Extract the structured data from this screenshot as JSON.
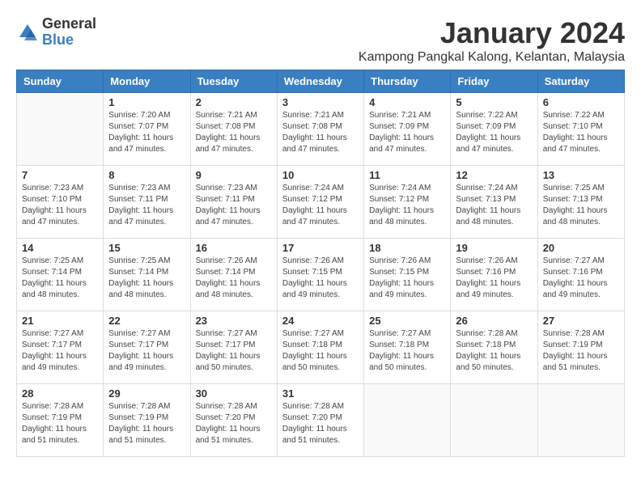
{
  "logo": {
    "general": "General",
    "blue": "Blue"
  },
  "header": {
    "month": "January 2024",
    "location": "Kampong Pangkal Kalong, Kelantan, Malaysia"
  },
  "weekdays": [
    "Sunday",
    "Monday",
    "Tuesday",
    "Wednesday",
    "Thursday",
    "Friday",
    "Saturday"
  ],
  "weeks": [
    [
      {
        "day": "",
        "sunrise": "",
        "sunset": "",
        "daylight": ""
      },
      {
        "day": "1",
        "sunrise": "Sunrise: 7:20 AM",
        "sunset": "Sunset: 7:07 PM",
        "daylight": "Daylight: 11 hours and 47 minutes."
      },
      {
        "day": "2",
        "sunrise": "Sunrise: 7:21 AM",
        "sunset": "Sunset: 7:08 PM",
        "daylight": "Daylight: 11 hours and 47 minutes."
      },
      {
        "day": "3",
        "sunrise": "Sunrise: 7:21 AM",
        "sunset": "Sunset: 7:08 PM",
        "daylight": "Daylight: 11 hours and 47 minutes."
      },
      {
        "day": "4",
        "sunrise": "Sunrise: 7:21 AM",
        "sunset": "Sunset: 7:09 PM",
        "daylight": "Daylight: 11 hours and 47 minutes."
      },
      {
        "day": "5",
        "sunrise": "Sunrise: 7:22 AM",
        "sunset": "Sunset: 7:09 PM",
        "daylight": "Daylight: 11 hours and 47 minutes."
      },
      {
        "day": "6",
        "sunrise": "Sunrise: 7:22 AM",
        "sunset": "Sunset: 7:10 PM",
        "daylight": "Daylight: 11 hours and 47 minutes."
      }
    ],
    [
      {
        "day": "7",
        "sunrise": "Sunrise: 7:23 AM",
        "sunset": "Sunset: 7:10 PM",
        "daylight": "Daylight: 11 hours and 47 minutes."
      },
      {
        "day": "8",
        "sunrise": "Sunrise: 7:23 AM",
        "sunset": "Sunset: 7:11 PM",
        "daylight": "Daylight: 11 hours and 47 minutes."
      },
      {
        "day": "9",
        "sunrise": "Sunrise: 7:23 AM",
        "sunset": "Sunset: 7:11 PM",
        "daylight": "Daylight: 11 hours and 47 minutes."
      },
      {
        "day": "10",
        "sunrise": "Sunrise: 7:24 AM",
        "sunset": "Sunset: 7:12 PM",
        "daylight": "Daylight: 11 hours and 47 minutes."
      },
      {
        "day": "11",
        "sunrise": "Sunrise: 7:24 AM",
        "sunset": "Sunset: 7:12 PM",
        "daylight": "Daylight: 11 hours and 48 minutes."
      },
      {
        "day": "12",
        "sunrise": "Sunrise: 7:24 AM",
        "sunset": "Sunset: 7:13 PM",
        "daylight": "Daylight: 11 hours and 48 minutes."
      },
      {
        "day": "13",
        "sunrise": "Sunrise: 7:25 AM",
        "sunset": "Sunset: 7:13 PM",
        "daylight": "Daylight: 11 hours and 48 minutes."
      }
    ],
    [
      {
        "day": "14",
        "sunrise": "Sunrise: 7:25 AM",
        "sunset": "Sunset: 7:14 PM",
        "daylight": "Daylight: 11 hours and 48 minutes."
      },
      {
        "day": "15",
        "sunrise": "Sunrise: 7:25 AM",
        "sunset": "Sunset: 7:14 PM",
        "daylight": "Daylight: 11 hours and 48 minutes."
      },
      {
        "day": "16",
        "sunrise": "Sunrise: 7:26 AM",
        "sunset": "Sunset: 7:14 PM",
        "daylight": "Daylight: 11 hours and 48 minutes."
      },
      {
        "day": "17",
        "sunrise": "Sunrise: 7:26 AM",
        "sunset": "Sunset: 7:15 PM",
        "daylight": "Daylight: 11 hours and 49 minutes."
      },
      {
        "day": "18",
        "sunrise": "Sunrise: 7:26 AM",
        "sunset": "Sunset: 7:15 PM",
        "daylight": "Daylight: 11 hours and 49 minutes."
      },
      {
        "day": "19",
        "sunrise": "Sunrise: 7:26 AM",
        "sunset": "Sunset: 7:16 PM",
        "daylight": "Daylight: 11 hours and 49 minutes."
      },
      {
        "day": "20",
        "sunrise": "Sunrise: 7:27 AM",
        "sunset": "Sunset: 7:16 PM",
        "daylight": "Daylight: 11 hours and 49 minutes."
      }
    ],
    [
      {
        "day": "21",
        "sunrise": "Sunrise: 7:27 AM",
        "sunset": "Sunset: 7:17 PM",
        "daylight": "Daylight: 11 hours and 49 minutes."
      },
      {
        "day": "22",
        "sunrise": "Sunrise: 7:27 AM",
        "sunset": "Sunset: 7:17 PM",
        "daylight": "Daylight: 11 hours and 49 minutes."
      },
      {
        "day": "23",
        "sunrise": "Sunrise: 7:27 AM",
        "sunset": "Sunset: 7:17 PM",
        "daylight": "Daylight: 11 hours and 50 minutes."
      },
      {
        "day": "24",
        "sunrise": "Sunrise: 7:27 AM",
        "sunset": "Sunset: 7:18 PM",
        "daylight": "Daylight: 11 hours and 50 minutes."
      },
      {
        "day": "25",
        "sunrise": "Sunrise: 7:27 AM",
        "sunset": "Sunset: 7:18 PM",
        "daylight": "Daylight: 11 hours and 50 minutes."
      },
      {
        "day": "26",
        "sunrise": "Sunrise: 7:28 AM",
        "sunset": "Sunset: 7:18 PM",
        "daylight": "Daylight: 11 hours and 50 minutes."
      },
      {
        "day": "27",
        "sunrise": "Sunrise: 7:28 AM",
        "sunset": "Sunset: 7:19 PM",
        "daylight": "Daylight: 11 hours and 51 minutes."
      }
    ],
    [
      {
        "day": "28",
        "sunrise": "Sunrise: 7:28 AM",
        "sunset": "Sunset: 7:19 PM",
        "daylight": "Daylight: 11 hours and 51 minutes."
      },
      {
        "day": "29",
        "sunrise": "Sunrise: 7:28 AM",
        "sunset": "Sunset: 7:19 PM",
        "daylight": "Daylight: 11 hours and 51 minutes."
      },
      {
        "day": "30",
        "sunrise": "Sunrise: 7:28 AM",
        "sunset": "Sunset: 7:20 PM",
        "daylight": "Daylight: 11 hours and 51 minutes."
      },
      {
        "day": "31",
        "sunrise": "Sunrise: 7:28 AM",
        "sunset": "Sunset: 7:20 PM",
        "daylight": "Daylight: 11 hours and 51 minutes."
      },
      {
        "day": "",
        "sunrise": "",
        "sunset": "",
        "daylight": ""
      },
      {
        "day": "",
        "sunrise": "",
        "sunset": "",
        "daylight": ""
      },
      {
        "day": "",
        "sunrise": "",
        "sunset": "",
        "daylight": ""
      }
    ]
  ]
}
